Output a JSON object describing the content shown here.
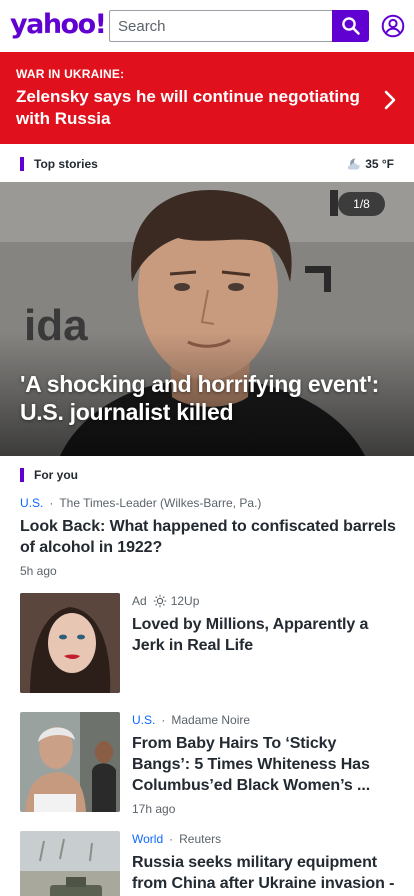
{
  "header": {
    "logo": "yahoo!",
    "search_placeholder": "Search"
  },
  "breaking": {
    "kicker": "WAR IN UKRAINE:",
    "headline": "Zelensky says he will continue negotiating with Russia"
  },
  "top_stories": {
    "title": "Top stories",
    "weather_temp": "35 °F"
  },
  "hero": {
    "counter": "1/8",
    "headline": "'A shocking and horrifying event': U.S. journalist killed",
    "backdrop_text": "ida"
  },
  "for_you": {
    "title": "For you"
  },
  "stories": [
    {
      "category": "U.S.",
      "source": "The Times-Leader (Wilkes-Barre, Pa.)",
      "title": "Look Back: What happened to confiscated barrels of alcohol in 1922?",
      "time": "5h ago"
    },
    {
      "ad_label": "Ad",
      "source": "12Up",
      "title": "Loved by Millions, Apparently a Jerk in Real Life"
    },
    {
      "category": "U.S.",
      "source": "Madame Noire",
      "title": "From Baby Hairs To ‘Sticky Bangs’: 5 Times Whiteness Has Columbus’ed Black Women’s ...",
      "time": "17h ago"
    },
    {
      "category": "World",
      "source": "Reuters",
      "title": "Russia seeks military equipment from China after Ukraine invasion -"
    }
  ],
  "colors": {
    "brand": "#6001d2",
    "breaking": "#e0111c",
    "link": "#0f69ff"
  }
}
